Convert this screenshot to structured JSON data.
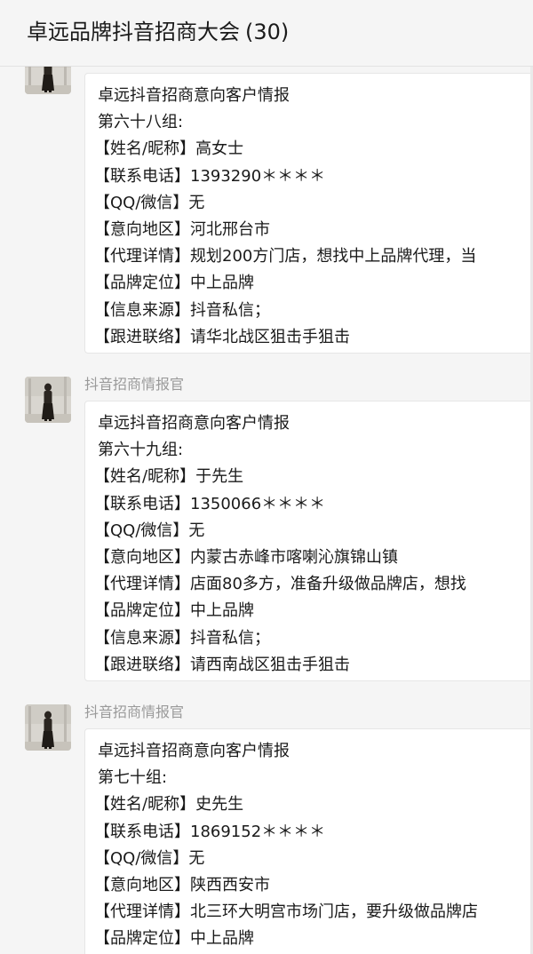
{
  "header": {
    "title": "卓远品牌抖音招商大会",
    "count": "(30)"
  },
  "messages": [
    {
      "sender": "",
      "lines": [
        "卓远抖音招商意向客户情报",
        "第六十八组:",
        "【姓名/昵称】高女士",
        "【联系电话】1393290＊＊＊＊",
        "【QQ/微信】无",
        "【意向地区】河北邢台市",
        "【代理详情】规划200方门店，想找中上品牌代理，当",
        "【品牌定位】中上品牌",
        "【信息来源】抖音私信；",
        "【跟进联络】请华北战区狙击手狙击"
      ]
    },
    {
      "sender": "抖音招商情报官",
      "lines": [
        "卓远抖音招商意向客户情报",
        "第六十九组:",
        "【姓名/昵称】于先生",
        "【联系电话】1350066＊＊＊＊",
        "【QQ/微信】无",
        "【意向地区】内蒙古赤峰市喀喇沁旗锦山镇",
        "【代理详情】店面80多方，准备升级做品牌店，想找",
        "【品牌定位】中上品牌",
        "【信息来源】抖音私信；",
        "【跟进联络】请西南战区狙击手狙击"
      ]
    },
    {
      "sender": "抖音招商情报官",
      "lines": [
        "卓远抖音招商意向客户情报",
        "第七十组:",
        "【姓名/昵称】史先生",
        "【联系电话】1869152＊＊＊＊",
        "【QQ/微信】无",
        "【意向地区】陕西西安市",
        "【代理详情】北三环大明宫市场门店，要升级做品牌店",
        "【品牌定位】中上品牌"
      ]
    }
  ]
}
